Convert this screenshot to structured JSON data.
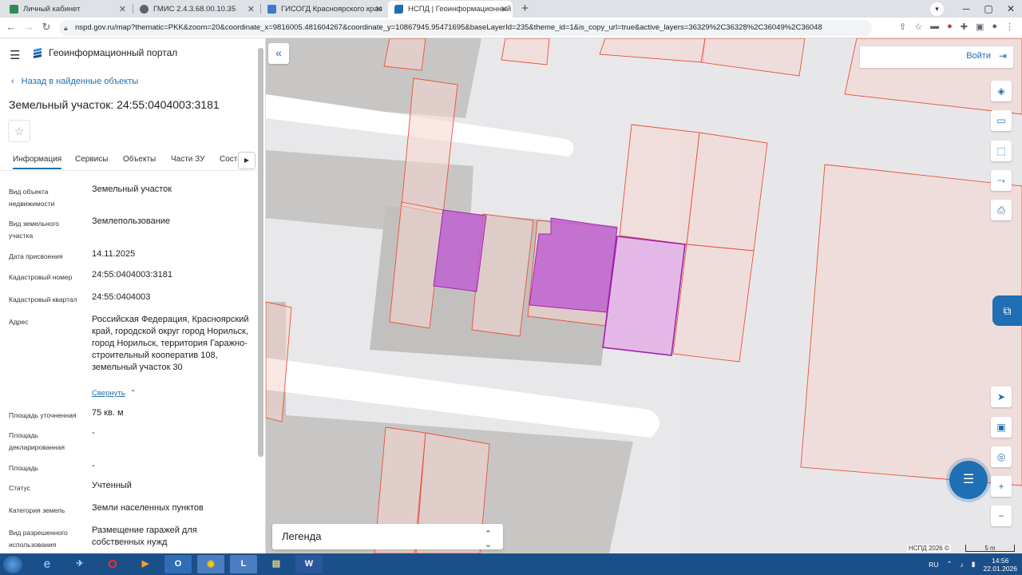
{
  "browser": {
    "tabs": [
      {
        "title": "Личный кабинет",
        "active": false,
        "favicon_color": "#2e8b57"
      },
      {
        "title": "ГМИС 2.4.3.68.00.10.35",
        "active": false,
        "favicon_color": "#5f6368"
      },
      {
        "title": "ГИСОГД Красноярского края",
        "active": false,
        "favicon_color": "#3d7ac7"
      },
      {
        "title": "НСПД | Геоинформационный п",
        "active": true,
        "favicon_color": "#1f6fb2"
      }
    ],
    "url": "nspd.gov.ru/map?thematic=PKK&zoom=20&coordinate_x=9816005.481604267&coordinate_y=10867945.95471695&baseLayerId=235&theme_id=1&is_copy_url=true&active_layers=36329%2C36328%2C36049%2C36048"
  },
  "panel": {
    "portal_title": "Геоинформационный портал",
    "back_link": "Назад в найденные объекты",
    "object_title": "Земельный участок: 24:55:0404003:3181",
    "tabs": [
      "Информация",
      "Сервисы",
      "Объекты",
      "Части ЗУ",
      "Соста"
    ],
    "active_tab": "Информация",
    "fields": [
      {
        "label": "Вид объекта недвижимости",
        "value": "Земельный участок"
      },
      {
        "label": "Вид земельного участка",
        "value": "Землепользование"
      },
      {
        "label": "Дата присвоения",
        "value": "14.11.2025"
      },
      {
        "label": "Кадастровый номер",
        "value": "24:55:0404003:3181"
      },
      {
        "label": "Кадастровый квартал",
        "value": "24:55:0404003"
      },
      {
        "label": "Адрес",
        "value": "Российская Федерация, Красноярский край, городской округ город Норильск, город Норильск, территория Гаражно-строительный кооператив 108, земельный участок 30"
      },
      {
        "label": "Площадь уточненная",
        "value": "75 кв. м"
      },
      {
        "label": "Площадь декларированная",
        "value": "-"
      },
      {
        "label": "Площадь",
        "value": "-"
      },
      {
        "label": "Статус",
        "value": "Учтенный"
      },
      {
        "label": "Категория земель",
        "value": "Земли населенных пунктов"
      },
      {
        "label": "Вид разрешенного использования",
        "value": "Размещение гаражей для собственных нужд"
      }
    ],
    "collapse_link": "Свернуть"
  },
  "map": {
    "login_label": "Войти",
    "legend_label": "Легенда",
    "attribution": "НСПД 2026 ©",
    "scale_label": "5 m",
    "colors": {
      "parcel_border": "#e8523a",
      "parcel_fill": "#f6d6d0",
      "selected_fill": "#c061d0",
      "selected_border": "#a020b0",
      "accent": "#1f6fb2"
    }
  },
  "taskbar": {
    "lang": "RU",
    "time": "14:56",
    "date": "22.01.2026"
  }
}
